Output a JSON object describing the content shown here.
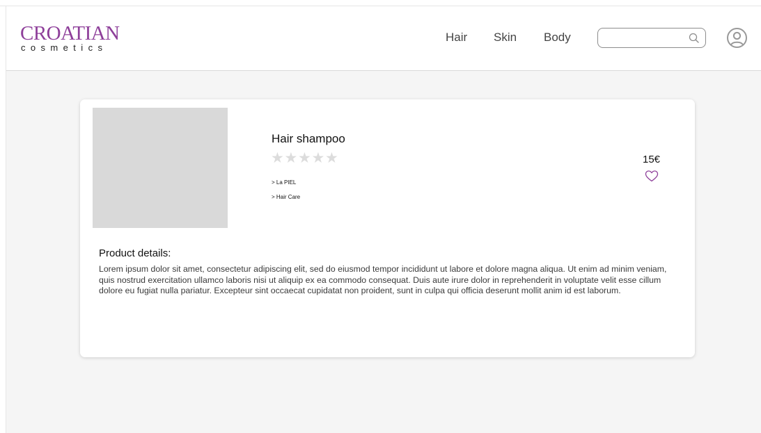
{
  "brand": {
    "name": "CROATIAN",
    "tagline": "cosmetics",
    "accent_color": "#8e3f9a"
  },
  "nav": {
    "links": [
      {
        "label": "Hair"
      },
      {
        "label": "Skin"
      },
      {
        "label": "Body"
      }
    ],
    "search": {
      "value": "",
      "placeholder": "",
      "icon": "search-icon"
    },
    "account_icon": "user-circle-icon"
  },
  "product": {
    "name": "Hair shampoo",
    "rating": 0,
    "rating_max": 5,
    "breadcrumbs": [
      "> La PIEL",
      "> Hair Care"
    ],
    "price": "15€",
    "favorite_icon": "heart-icon",
    "details_title": "Product details:",
    "details_text": "Lorem ipsum dolor sit amet, consectetur adipiscing elit, sed do eiusmod tempor incididunt ut labore et dolore magna aliqua. Ut enim ad minim veniam, quis nostrud exercitation ullamco laboris nisi ut aliquip ex ea commodo consequat. Duis aute irure dolor in reprehenderit in voluptate velit esse cillum dolore eu fugiat nulla pariatur. Excepteur sint occaecat cupidatat non proident, sunt in culpa qui officia deserunt mollit anim id est laborum."
  },
  "colors": {
    "background": "#f5f5f5",
    "card": "#ffffff",
    "image_placeholder": "#d9d9d9",
    "star_empty": "#dcdcdc",
    "heart": "#8e3f9a"
  }
}
